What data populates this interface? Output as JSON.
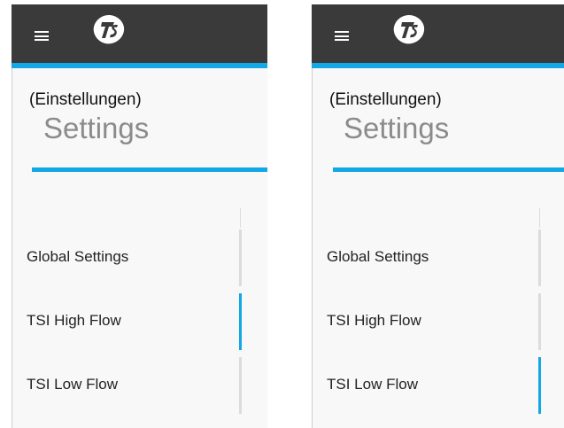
{
  "panels": [
    {
      "subtitle": "(Einstellungen)",
      "title": "Settings",
      "menu": [
        {
          "label": "Global Settings",
          "active": false
        },
        {
          "label": "TSI High Flow",
          "active": true
        },
        {
          "label": "TSI Low Flow",
          "active": false
        }
      ]
    },
    {
      "subtitle": "(Einstellungen)",
      "title": "Settings",
      "menu": [
        {
          "label": "Global Settings",
          "active": false
        },
        {
          "label": "TSI High Flow",
          "active": false
        },
        {
          "label": "TSI Low Flow",
          "active": true
        }
      ]
    }
  ],
  "icons": {
    "menu": "hamburger-menu-icon",
    "logo": "tsi-logo-icon"
  },
  "colors": {
    "header": "#3a3a3a",
    "accent": "#12a8e6",
    "title": "#8b8b8b",
    "inactive_bar": "#dcdcdc"
  }
}
